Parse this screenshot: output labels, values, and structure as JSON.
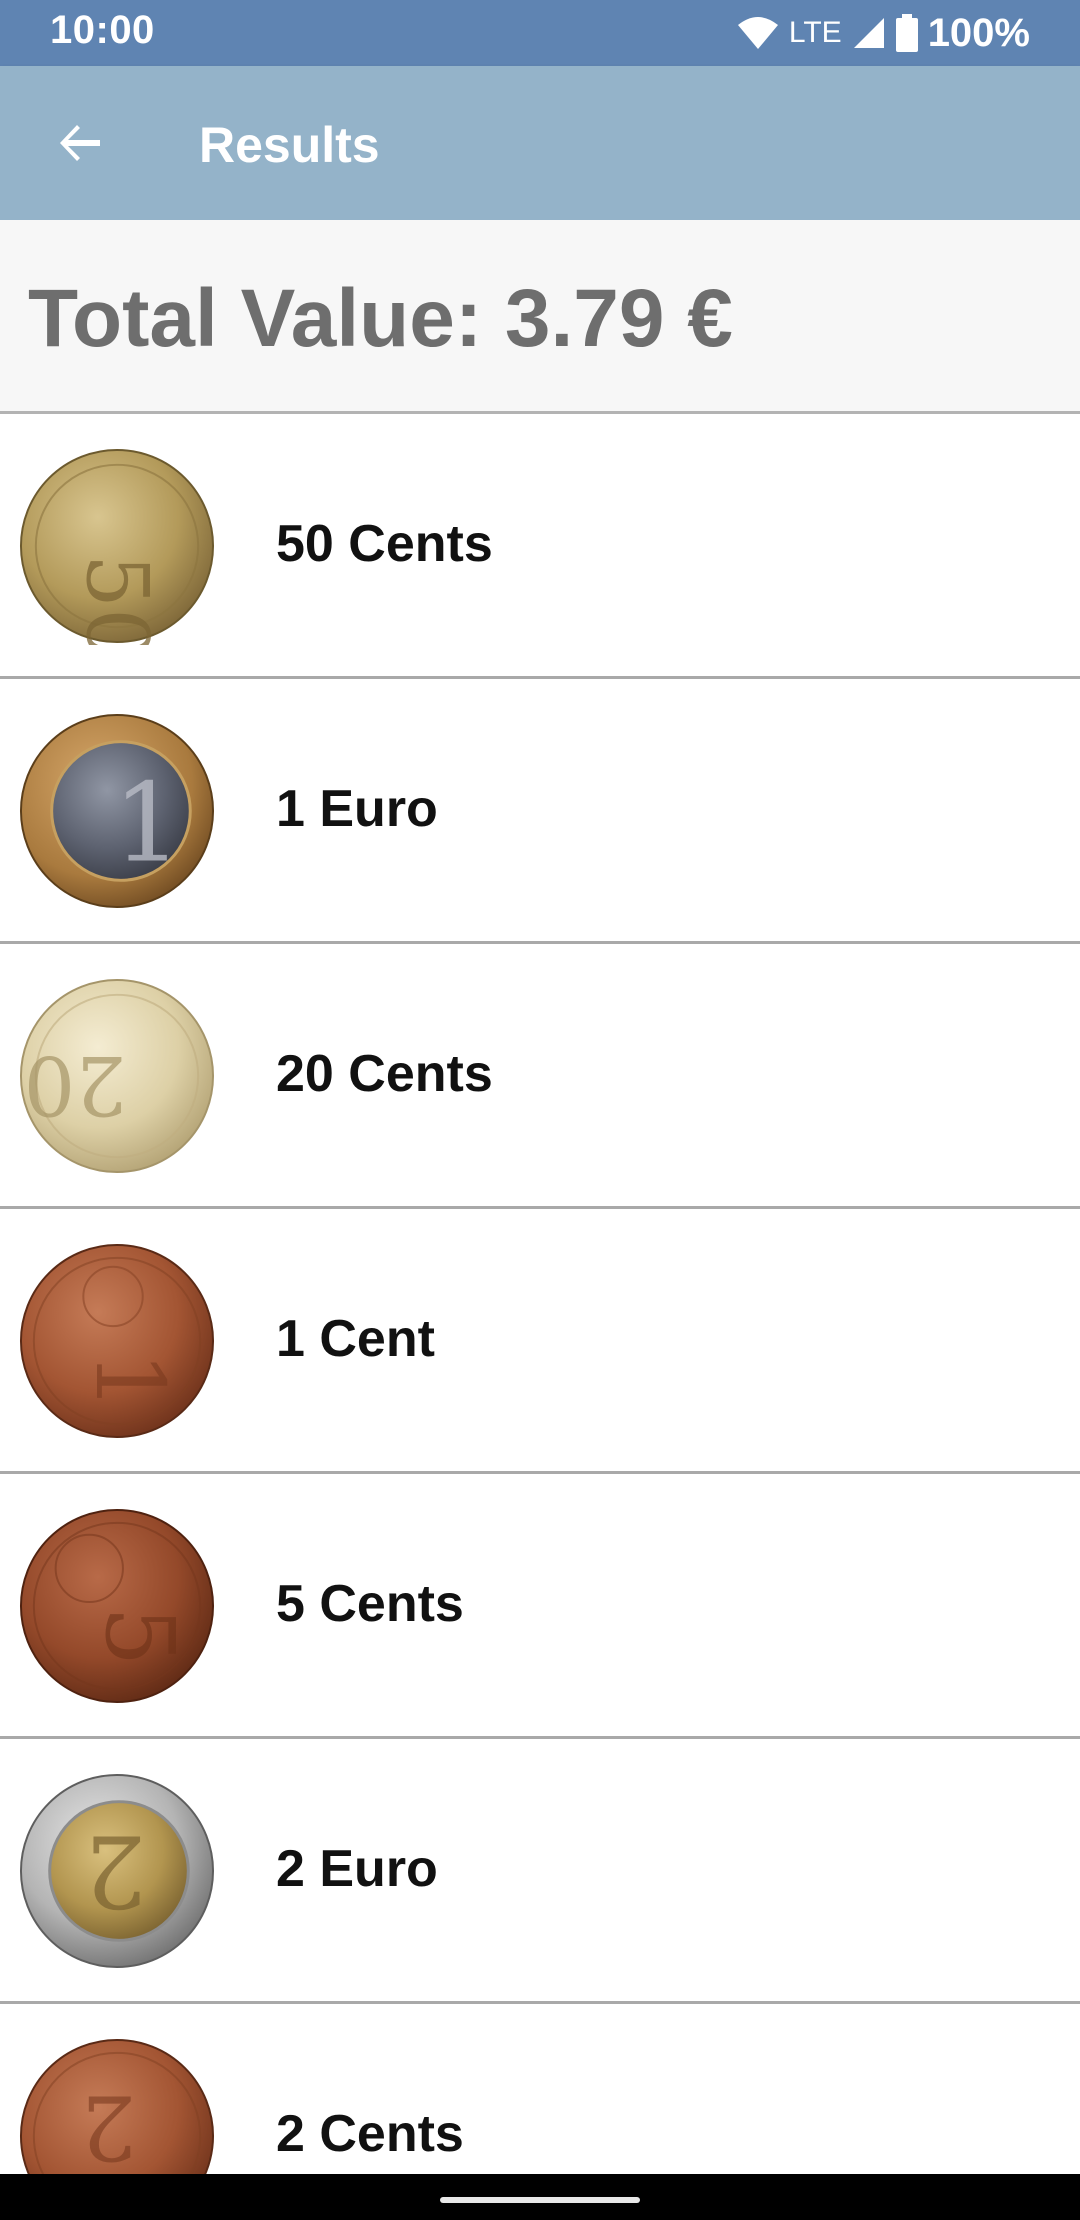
{
  "status_bar": {
    "time": "10:00",
    "network": "LTE",
    "battery": "100%",
    "icons": [
      "wifi-icon",
      "cell-signal-icon",
      "battery-icon"
    ]
  },
  "app_bar": {
    "title": "Results",
    "back_icon": "arrow-back-icon"
  },
  "total": {
    "label": "Total Value: 3.79 €"
  },
  "coins": [
    {
      "label": "50 Cents",
      "value_text": "50",
      "style": "gold"
    },
    {
      "label": "1 Euro",
      "value_text": "1",
      "style": "bimetal-1"
    },
    {
      "label": "20 Cents",
      "value_text": "20",
      "style": "pale-gold"
    },
    {
      "label": "1 Cent",
      "value_text": "1",
      "style": "copper"
    },
    {
      "label": "5 Cents",
      "value_text": "5",
      "style": "copper-dark"
    },
    {
      "label": "2 Euro",
      "value_text": "2",
      "style": "bimetal-2"
    },
    {
      "label": "2 Cents",
      "value_text": "2",
      "style": "copper"
    }
  ],
  "colors": {
    "status_bar": "#5f84b2",
    "app_bar": "#94b3c9",
    "total_text": "#6e6e6e",
    "divider": "#a9a9a9"
  }
}
